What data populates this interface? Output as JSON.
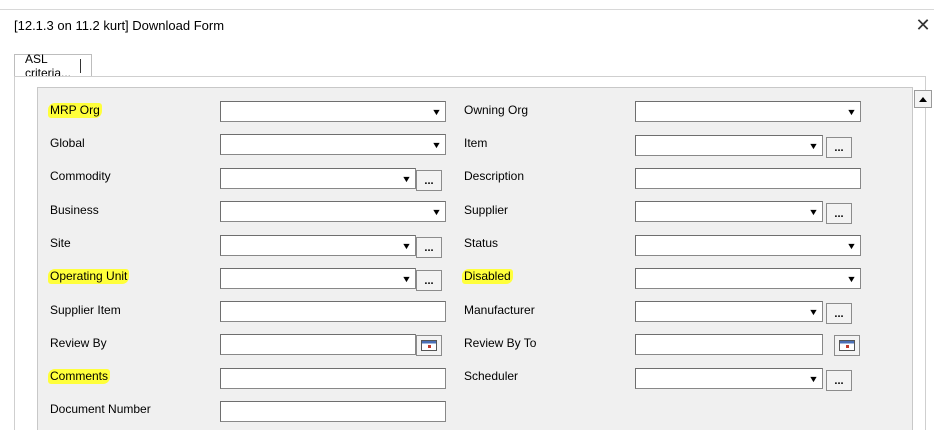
{
  "window": {
    "title": "[12.1.3 on 11.2 kurt] Download Form",
    "close_label": "✕"
  },
  "tabs": [
    {
      "label": "ASL criteria..."
    }
  ],
  "lov_label": "...",
  "dropdown_arrow": "▼",
  "left_fields": [
    {
      "label": "MRP Org",
      "value": ""
    },
    {
      "label": "Global",
      "value": ""
    },
    {
      "label": "Commodity",
      "value": ""
    },
    {
      "label": "Business",
      "value": ""
    },
    {
      "label": "Site",
      "value": ""
    },
    {
      "label": "Operating Unit",
      "value": ""
    },
    {
      "label": "Supplier Item",
      "value": ""
    },
    {
      "label": "Review By",
      "value": ""
    },
    {
      "label": "Comments",
      "value": ""
    },
    {
      "label": "Document Number",
      "value": ""
    }
  ],
  "right_fields": [
    {
      "label": "Owning Org",
      "value": ""
    },
    {
      "label": "Item",
      "value": ""
    },
    {
      "label": "Description",
      "value": ""
    },
    {
      "label": "Supplier",
      "value": ""
    },
    {
      "label": "Status",
      "value": ""
    },
    {
      "label": "Disabled",
      "value": ""
    },
    {
      "label": "Manufacturer",
      "value": ""
    },
    {
      "label": "Review By To",
      "value": ""
    },
    {
      "label": "Scheduler",
      "value": ""
    }
  ],
  "colors": {
    "highlight": "#ffff3b",
    "panel_bg": "#f0f0f0"
  }
}
